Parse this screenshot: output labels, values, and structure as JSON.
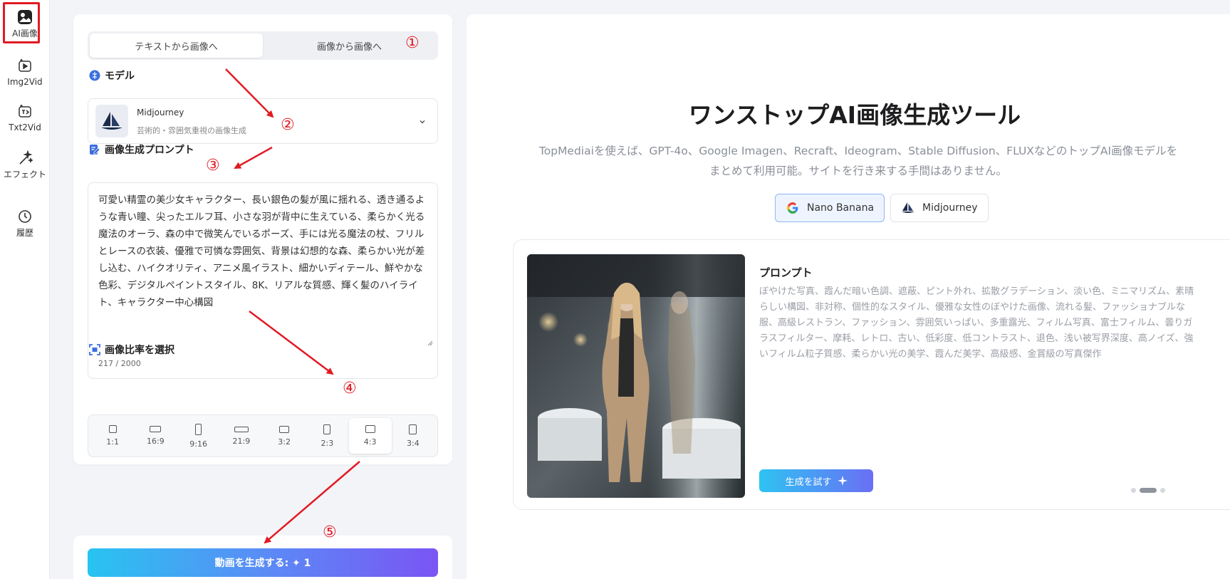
{
  "sidebar": {
    "items": [
      {
        "label": "AI画像",
        "icon": "image-icon"
      },
      {
        "label": "Img2Vid",
        "icon": "image-to-video-icon"
      },
      {
        "label": "Txt2Vid",
        "icon": "text-to-video-icon"
      },
      {
        "label": "エフェクト",
        "icon": "magic-wand-icon"
      },
      {
        "label": "履歴",
        "icon": "clock-icon"
      }
    ]
  },
  "left": {
    "tabs": [
      "テキストから画像へ",
      "画像から画像へ"
    ],
    "model_section_title": "モデル",
    "model": {
      "name": "Midjourney",
      "desc": "芸術的・雰囲気重視の画像生成"
    },
    "prompt_section_title": "画像生成プロンプト",
    "prompt_text": "可愛い精霊の美少女キャラクター、長い銀色の髪が風に揺れる、透き通るような青い瞳、尖ったエルフ耳、小さな羽が背中に生えている、柔らかく光る魔法のオーラ、森の中で微笑んでいるポーズ、手には光る魔法の杖、フリルとレースの衣装、優雅で可憐な雰囲気、背景は幻想的な森、柔らかい光が差し込む、ハイクオリティ、アニメ風イラスト、細かいディテール、鮮やかな色彩、デジタルペイントスタイル、8K、リアルな質感、輝く髪のハイライト、キャラクター中心構図",
    "prompt_count": "217 / 2000",
    "ratio_section_title": "画像比率を選択",
    "ratios": [
      "1:1",
      "16:9",
      "9:16",
      "21:9",
      "3:2",
      "2:3",
      "4:3",
      "3:4"
    ],
    "selected_ratio": "4:3",
    "generate_label": "動画を生成する: ✦ 1"
  },
  "right": {
    "title": "ワンストップAI画像生成ツール",
    "subtitle": "TopMediaiを使えば、GPT-4o、Google Imagen、Recraft、Ideogram、Stable Diffusion、FLUXなどのトップAI画像モデルをまとめて利用可能。サイトを行き来する手間はありません。",
    "model_pills": [
      "Nano Banana",
      "Midjourney"
    ],
    "showcase": {
      "label": "プロンプト",
      "text": "ぼやけた写真、霞んだ暗い色調、遮蔽、ピント外れ、拡散グラデーション、淡い色、ミニマリズム、素晴らしい構図、非対称、個性的なスタイル、優雅な女性のぼやけた画像、流れる髪、ファッショナブルな服、高級レストラン、ファッション、雰囲気いっぱい、多重露光、フィルム写真、富士フィルム、曇りガラスフィルター、摩耗、レトロ、古い、低彩度、低コントラスト、退色、浅い被写界深度、高ノイズ、強いフィルム粒子質感、柔らかい光の美学、霞んだ美学、高級感、金賞級の写真傑作",
      "try_label": "生成を試す"
    }
  },
  "annotations": [
    "①",
    "②",
    "③",
    "④",
    "⑤"
  ],
  "colors": {
    "accent_red": "#e11b22",
    "gradient_start": "#28c4f0",
    "gradient_end": "#7a55f4"
  }
}
